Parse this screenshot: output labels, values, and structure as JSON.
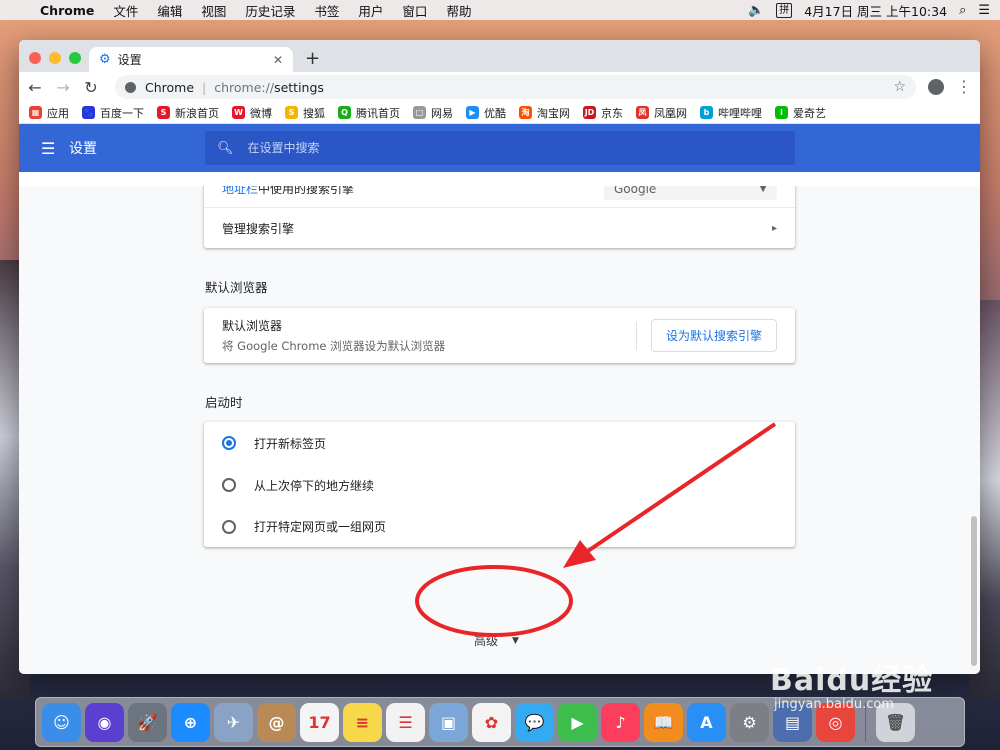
{
  "menubar": {
    "apple_icon": "apple-icon",
    "app_name": "Chrome",
    "items": [
      "文件",
      "编辑",
      "视图",
      "历史记录",
      "书签",
      "用户",
      "窗口",
      "帮助"
    ],
    "ime_label": "拼",
    "datetime": "4月17日 周三 上午10:34"
  },
  "browser": {
    "tab_title": "设置",
    "omnibox": {
      "site_label": "Chrome",
      "url_scheme": "chrome://",
      "url_path": "settings"
    },
    "bookmarks": [
      {
        "label": "应用",
        "color": "#e94235",
        "glyph": "▦"
      },
      {
        "label": "百度一下",
        "color": "#2932e1",
        "glyph": "🐾"
      },
      {
        "label": "新浪首页",
        "color": "#e6162d",
        "glyph": "S"
      },
      {
        "label": "微博",
        "color": "#e6162d",
        "glyph": "W"
      },
      {
        "label": "搜狐",
        "color": "#f5b400",
        "glyph": "S"
      },
      {
        "label": "腾讯首页",
        "color": "#1aad19",
        "glyph": "Q"
      },
      {
        "label": "网易",
        "color": "#999999",
        "glyph": "□"
      },
      {
        "label": "优酷",
        "color": "#1e8ef2",
        "glyph": "▶"
      },
      {
        "label": "淘宝网",
        "color": "#ff5000",
        "glyph": "淘"
      },
      {
        "label": "京东",
        "color": "#c81623",
        "glyph": "JD"
      },
      {
        "label": "凤凰网",
        "color": "#e0312a",
        "glyph": "凤"
      },
      {
        "label": "哔哩哔哩",
        "color": "#00a1d6",
        "glyph": "b"
      },
      {
        "label": "爱奇艺",
        "color": "#00be06",
        "glyph": "i"
      }
    ]
  },
  "settings": {
    "header_title": "设置",
    "search_placeholder": "在设置中搜索",
    "search_engine": {
      "address_bar_link": "地址栏",
      "address_bar_rest": "中使用的搜索引擎",
      "selected_engine": "Google",
      "manage_label": "管理搜索引擎"
    },
    "default_browser": {
      "section_title": "默认浏览器",
      "row_title": "默认浏览器",
      "row_subtitle": "将 Google Chrome 浏览器设为默认浏览器",
      "button_label": "设为默认搜索引擎"
    },
    "startup": {
      "section_title": "启动时",
      "options": [
        "打开新标签页",
        "从上次停下的地方继续",
        "打开特定网页或一组网页"
      ],
      "selected_index": 0
    },
    "advanced_label": "高级"
  },
  "dock": {
    "apps": [
      {
        "name": "finder-icon",
        "color": "#3b8ee8",
        "glyph": "☺"
      },
      {
        "name": "siri-icon",
        "color": "#5a3fd0",
        "glyph": "◉"
      },
      {
        "name": "launchpad-icon",
        "color": "#6c7480",
        "glyph": "🚀"
      },
      {
        "name": "safari-icon",
        "color": "#1a8cff",
        "glyph": "⊕"
      },
      {
        "name": "photo-booth-icon",
        "color": "#8aa3c4",
        "glyph": "✈"
      },
      {
        "name": "contacts-icon",
        "color": "#b88a55",
        "glyph": "@"
      },
      {
        "name": "calendar-icon",
        "color": "#f4f4f4",
        "glyph": "17"
      },
      {
        "name": "notes-icon",
        "color": "#f7d84a",
        "glyph": "≡"
      },
      {
        "name": "reminders-icon",
        "color": "#f2f2f2",
        "glyph": "☰"
      },
      {
        "name": "preview-icon",
        "color": "#7aa6d8",
        "glyph": "▣"
      },
      {
        "name": "photos-icon",
        "color": "#f3f3f3",
        "glyph": "✿"
      },
      {
        "name": "messages-icon",
        "color": "#34aaf3",
        "glyph": "💬"
      },
      {
        "name": "facetime-icon",
        "color": "#3dbe4c",
        "glyph": "▶"
      },
      {
        "name": "music-icon",
        "color": "#fa3e5b",
        "glyph": "♪"
      },
      {
        "name": "books-icon",
        "color": "#f28c1d",
        "glyph": "📖"
      },
      {
        "name": "app-store-icon",
        "color": "#2a8ff4",
        "glyph": "A"
      },
      {
        "name": "system-preferences-icon",
        "color": "#7c7f86",
        "glyph": "⚙"
      },
      {
        "name": "migration-icon",
        "color": "#4c6eae",
        "glyph": "▤"
      },
      {
        "name": "chrome-icon",
        "color": "#e8453c",
        "glyph": "◎"
      }
    ],
    "trash": {
      "name": "trash-icon",
      "color": "#d0d4da",
      "glyph": "🗑"
    }
  },
  "watermark": {
    "main": "Baidu经验",
    "sub": "jingyan.baidu.com"
  },
  "colors": {
    "settings_blue": "#3367d6",
    "link_blue": "#1a73e8",
    "annotation_red": "#e8262a"
  }
}
